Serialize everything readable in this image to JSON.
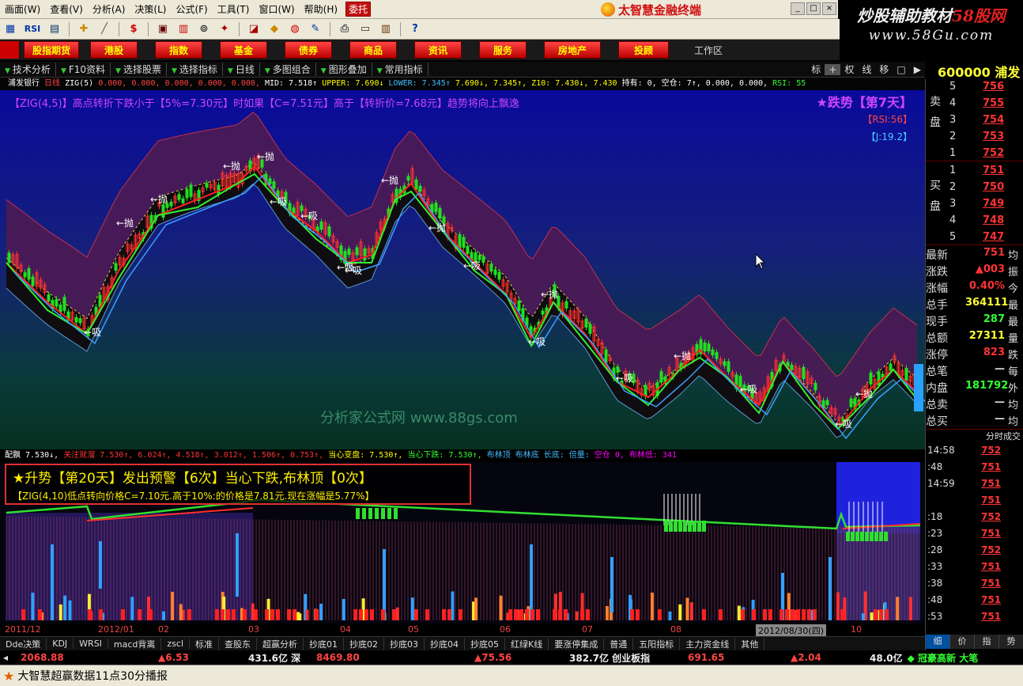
{
  "menu": {
    "items": [
      "画面(W)",
      "查看(V)",
      "分析(A)",
      "决策(L)",
      "公式(F)",
      "工具(T)",
      "窗口(W)",
      "帮助(H)"
    ],
    "weituo": "委托",
    "app_title": "太智慧金融终端"
  },
  "watermark": {
    "line1_a": "炒股辅助教材",
    "line1_b": "58股网",
    "line2": "www.58Gu.com"
  },
  "toolbar": {
    "rsi": "RSI",
    "dollar": "$"
  },
  "nav": {
    "buttons": [
      "股指期货",
      "港股",
      "指数",
      "基金",
      "债券",
      "商品",
      "资讯",
      "服务",
      "房地产",
      "投顾"
    ],
    "workspace": "工作区"
  },
  "subtool": {
    "items": [
      "技术分析",
      "F10资料",
      "选择股票",
      "选择指标",
      "日线",
      "多图组合",
      "图形叠加",
      "常用指标"
    ],
    "right": [
      "标",
      "+",
      "权",
      "线",
      "移",
      "□",
      "▶"
    ]
  },
  "quote_header": "600000 浦发",
  "infoline": {
    "stock": "浦发银行",
    "period": "日线",
    "zig": "ZIG(5)",
    "mid": "MID: 7.518↑",
    "upper": "UPPER: 7.690↓",
    "lower": "LOWER: 7.345↑",
    "vals": "7.690↓, 7.345↑, Z10: 7.430↓, 7.430",
    "hold": "持有: 0, 空仓: 7↑, 0.000, 0.000,",
    "rsi": "RSI: 55"
  },
  "main": {
    "zig_text": "【ZIG(4,5)】高点转折下跌小于【5%=7.30元】时如果【C=7.51元】高于【转折价=7.68元】趋势将向上飘逸",
    "trend_label": "★跌势【第7天】",
    "rsi_label": "【RSI:56】",
    "j_label": "【J:19.2】",
    "watermark": "分析家公式网 www.88gs.com",
    "marker_sell": "抛",
    "marker_buy": "吸"
  },
  "ind2info": {
    "a": "配飘 7.530↓,",
    "b": "关注就溜 7.530↑, 6.024↑, 4.518↑, 3.012↑, 1.506↑, 0.753↑,",
    "c": "当心变盘: 7.530↑,",
    "d": "当心下跌: 7.530↑,",
    "e": "布林顶 布林底 长底: 倍量:",
    "f": "空仓 0, 布林低: 341"
  },
  "sub": {
    "warn1": "★升势【第20天】发出预警【6次】当心下跌,布林顶【0次】",
    "warn2": "【ZIG(4,10)低点转向价格C=7.10元.高于10%:的价格是7.81元.现在涨幅是5.77%】"
  },
  "xaxis": {
    "labels": [
      "2011/12",
      "2012/01",
      "02",
      "03",
      "04",
      "05",
      "06",
      "07",
      "08",
      "2012/08/30(四)",
      "10"
    ]
  },
  "tabs": [
    "Dde决策",
    "KDJ",
    "WRSI",
    "macd背离",
    "zscl",
    "标准",
    "查股东",
    "超赢分析",
    "抄底01",
    "抄底02",
    "抄底03",
    "抄底04",
    "抄底05",
    "红绿K线",
    "要涨停集成",
    "普通",
    "五阳指标",
    "主力资金线",
    "其他"
  ],
  "ticker": {
    "a": "2068.88",
    "b": "▲6.53",
    "c": "431.6亿 深",
    "d": "8469.80",
    "e": "▲75.56",
    "f": "382.7亿 创业板指",
    "g": "691.65",
    "h": "▲2.04",
    "i": "48.0亿",
    "j": "◆ 冠豪高新 大笔"
  },
  "status": "大智慧超赢数据11点30分播报",
  "orderbook": {
    "sell_label": "卖盘",
    "buy_label": "买盘",
    "sell": [
      {
        "n": "5",
        "p": "756",
        "v": "—"
      },
      {
        "n": "4",
        "p": "755",
        "v": "—"
      },
      {
        "n": "3",
        "p": "754",
        "v": "—"
      },
      {
        "n": "2",
        "p": "753",
        "v": "—"
      },
      {
        "n": "1",
        "p": "752",
        "v": "—"
      }
    ],
    "buy": [
      {
        "n": "1",
        "p": "751",
        "v": "—"
      },
      {
        "n": "2",
        "p": "750",
        "v": "—"
      },
      {
        "n": "3",
        "p": "749",
        "v": "—"
      },
      {
        "n": "4",
        "p": "748",
        "v": "—"
      },
      {
        "n": "5",
        "p": "747",
        "v": "—"
      }
    ]
  },
  "stats": [
    {
      "k": "最新",
      "v": "751",
      "x": "均",
      "c": "#f33"
    },
    {
      "k": "涨跌",
      "v": "▲003",
      "x": "振",
      "c": "#f33"
    },
    {
      "k": "涨幅",
      "v": "0.40%",
      "x": "今",
      "c": "#f33"
    },
    {
      "k": "总手",
      "v": "364111",
      "x": "最",
      "c": "#ff3"
    },
    {
      "k": "现手",
      "v": "287",
      "x": "最",
      "c": "#3f3"
    },
    {
      "k": "总额",
      "v": "27311",
      "x": "量",
      "c": "#ff3"
    },
    {
      "k": "涨停",
      "v": "823",
      "x": "跌",
      "c": "#f33"
    },
    {
      "k": "总笔",
      "v": "—",
      "x": "每",
      "c": "#ddd"
    },
    {
      "k": "内盘",
      "v": "181792",
      "x": "外",
      "c": "#3f3"
    },
    {
      "k": "总卖",
      "v": "—",
      "x": "均",
      "c": "#ddd"
    },
    {
      "k": "总买",
      "v": "—",
      "x": "均",
      "c": "#ddd"
    }
  ],
  "ticks_header": "分时成交",
  "ticks": [
    {
      "t": "14:58",
      "p": "752"
    },
    {
      "t": ":48",
      "p": "751"
    },
    {
      "t": "14:59",
      "p": "751"
    },
    {
      "t": "",
      "p": "751"
    },
    {
      "t": ":18",
      "p": "752"
    },
    {
      "t": ":23",
      "p": "751"
    },
    {
      "t": ":28",
      "p": "752"
    },
    {
      "t": ":33",
      "p": "751"
    },
    {
      "t": ":38",
      "p": "751"
    },
    {
      "t": ":48",
      "p": "751"
    },
    {
      "t": ":53",
      "p": "751"
    }
  ],
  "right_tabs": [
    "细",
    "价",
    "指",
    "势"
  ]
}
